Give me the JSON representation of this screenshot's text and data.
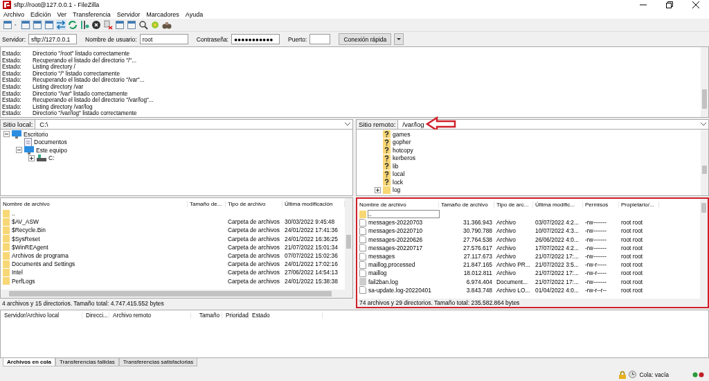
{
  "window": {
    "title": "sftp://root@127.0.0.1 - FileZilla"
  },
  "menu": [
    "Archivo",
    "Edición",
    "Ver",
    "Transferencia",
    "Servidor",
    "Marcadores",
    "Ayuda"
  ],
  "quickconnect": {
    "fields": [
      {
        "label": "Servidor:",
        "value": "sftp://127.0.0.1",
        "kind": "text"
      },
      {
        "label": "Nombre de usuario:",
        "value": "root",
        "kind": "text"
      },
      {
        "label": "Contraseña:",
        "value": "●●●●●●●●●●●",
        "kind": "password"
      },
      {
        "label": "Puerto:",
        "kind": "port"
      }
    ],
    "button": "Conexión rápida"
  },
  "log": [
    {
      "label": "Estado:",
      "message": "Directorio \"/root\" listado correctamente"
    },
    {
      "label": "Estado:",
      "message": "Recuperando el listado del directorio \"/\"..."
    },
    {
      "label": "Estado:",
      "message": "Listing directory /"
    },
    {
      "label": "Estado:",
      "message": "Directorio \"/\" listado correctamente"
    },
    {
      "label": "Estado:",
      "message": "Recuperando el listado del directorio \"/var\"..."
    },
    {
      "label": "Estado:",
      "message": "Listing directory /var"
    },
    {
      "label": "Estado:",
      "message": "Directorio \"/var\" listado correctamente"
    },
    {
      "label": "Estado:",
      "message": "Recuperando el listado del directorio \"/var/log\"..."
    },
    {
      "label": "Estado:",
      "message": "Listing directory /var/log"
    },
    {
      "label": "Estado:",
      "message": "Directorio \"/var/log\" listado correctamente"
    }
  ],
  "local_site": {
    "label": "Sitio local:",
    "path": "C:\\",
    "tree": [
      {
        "name": "Escritorio",
        "kind": "desktop",
        "expanded": true,
        "children": [
          {
            "name": "Documentos",
            "kind": "document"
          },
          {
            "name": "Este equipo",
            "kind": "computer",
            "expanded": true,
            "children": [
              {
                "name": "C:",
                "kind": "drive",
                "expanded": false
              }
            ]
          }
        ]
      }
    ],
    "columns": [
      "Nombre de archivo",
      "Tamaño de...",
      "Tipo de archivo",
      "Última modificación"
    ],
    "rows": [
      {
        "name": "..",
        "kind": "folder",
        "size": "",
        "type": "",
        "modified": ""
      },
      {
        "name": "$AV_ASW",
        "kind": "folder",
        "size": "",
        "type": "Carpeta de archivos",
        "modified": "30/03/2022 9:45:48"
      },
      {
        "name": "$Recycle.Bin",
        "kind": "folder",
        "size": "",
        "type": "Carpeta de archivos",
        "modified": "24/01/2022 17:41:36"
      },
      {
        "name": "$SysReset",
        "kind": "folder",
        "size": "",
        "type": "Carpeta de archivos",
        "modified": "24/01/2022 16:36:25"
      },
      {
        "name": "$WinREAgent",
        "kind": "folder",
        "size": "",
        "type": "Carpeta de archivos",
        "modified": "21/07/2022 15:01:34"
      },
      {
        "name": "Archivos de programa",
        "kind": "folder",
        "size": "",
        "type": "Carpeta de archivos",
        "modified": "07/07/2022 15:02:36"
      },
      {
        "name": "Documents and Settings",
        "kind": "folder",
        "size": "",
        "type": "Carpeta de archivos",
        "modified": "24/01/2022 17:02:16"
      },
      {
        "name": "Intel",
        "kind": "folder",
        "size": "",
        "type": "Carpeta de archivos",
        "modified": "27/06/2022 14:54:13"
      },
      {
        "name": "PerfLogs",
        "kind": "folder",
        "size": "",
        "type": "Carpeta de archivos",
        "modified": "24/01/2022 15:38:38"
      }
    ],
    "summary": "4 archivos y 15 directorios. Tamaño total: 4.747.415.552 bytes"
  },
  "remote_site": {
    "label": "Sitio remoto:",
    "path": "/var/log",
    "tree": [
      {
        "name": "games",
        "kind": "unknown"
      },
      {
        "name": "gopher",
        "kind": "unknown"
      },
      {
        "name": "hotcopy",
        "kind": "unknown"
      },
      {
        "name": "kerberos",
        "kind": "unknown"
      },
      {
        "name": "lib",
        "kind": "unknown"
      },
      {
        "name": "local",
        "kind": "unknown"
      },
      {
        "name": "lock",
        "kind": "unknown"
      },
      {
        "name": "log",
        "kind": "folder",
        "expanded": false
      }
    ],
    "columns": [
      "Nombre de archivo",
      "Tamaño de archivo",
      "Tipo de arc...",
      "Última modific...",
      "Permisos",
      "Propietario/..."
    ],
    "rows": [
      {
        "name": "..",
        "kind": "folder",
        "selected": true,
        "size": "",
        "type": "",
        "modified": "",
        "permissions": "",
        "owner": ""
      },
      {
        "name": "messages-20220703",
        "kind": "file",
        "selected": false,
        "size": "31.366.943",
        "type": "Archivo",
        "modified": "03/07/2022 4:2...",
        "permissions": "-rw-------",
        "owner": "root root"
      },
      {
        "name": "messages-20220710",
        "kind": "file",
        "selected": false,
        "size": "30.790.788",
        "type": "Archivo",
        "modified": "10/07/2022 4:3...",
        "permissions": "-rw-------",
        "owner": "root root"
      },
      {
        "name": "messages-20220626",
        "kind": "file",
        "selected": false,
        "size": "27.764.538",
        "type": "Archivo",
        "modified": "26/06/2022 4:0...",
        "permissions": "-rw-------",
        "owner": "root root"
      },
      {
        "name": "messages-20220717",
        "kind": "file",
        "selected": false,
        "size": "27.576.617",
        "type": "Archivo",
        "modified": "17/07/2022 4:2...",
        "permissions": "-rw-------",
        "owner": "root root"
      },
      {
        "name": "messages",
        "kind": "file",
        "selected": false,
        "size": "27.117.673",
        "type": "Archivo",
        "modified": "21/07/2022 17:...",
        "permissions": "-rw-------",
        "owner": "root root"
      },
      {
        "name": "maillog.processed",
        "kind": "file",
        "selected": false,
        "size": "21.847.165",
        "type": "Archivo PR...",
        "modified": "21/07/2022 3:5...",
        "permissions": "-rw-r-----",
        "owner": "root root"
      },
      {
        "name": "maillog",
        "kind": "file",
        "selected": false,
        "size": "18.012.811",
        "type": "Archivo",
        "modified": "21/07/2022 17:...",
        "permissions": "-rw-r-----",
        "owner": "root root"
      },
      {
        "name": "fail2ban.log",
        "kind": "document",
        "selected": false,
        "size": "6.974.404",
        "type": "Document...",
        "modified": "21/07/2022 17:...",
        "permissions": "-rw-------",
        "owner": "root root"
      },
      {
        "name": "sa-update.log-20220401",
        "kind": "file",
        "selected": false,
        "size": "3.843.748",
        "type": "Archivo LO...",
        "modified": "01/04/2022 4:0...",
        "permissions": "-rw-r--r--",
        "owner": "root root"
      }
    ],
    "summary": "74 archivos y 29 directorios. Tamaño total: 235.582.864 bytes"
  },
  "annotations": {
    "path_arrow": true,
    "list_highlight": true
  },
  "queue": {
    "columns": [
      "Servidor/Archivo local",
      "Direcci...",
      "Archivo remoto",
      "Tamaño",
      "Prioridad",
      "Estado"
    ],
    "tabs": [
      {
        "label": "Archivos en cola",
        "selected": true
      },
      {
        "label": "Transferencias fallidas",
        "selected": false
      },
      {
        "label": "Transferencias satisfactorias",
        "selected": false
      }
    ]
  },
  "status_bar": {
    "queue": "Cola: vacía"
  }
}
